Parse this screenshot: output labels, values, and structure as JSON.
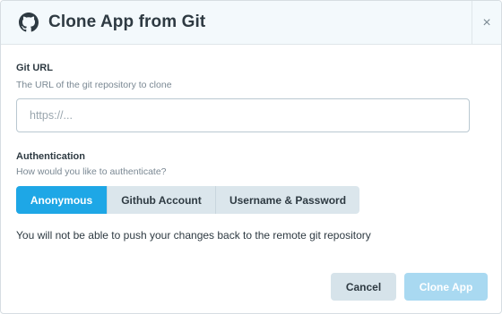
{
  "dialog": {
    "title": "Clone App from Git",
    "close_symbol": "×"
  },
  "icons": {
    "header_icon": "github-icon",
    "close_icon": "close-icon"
  },
  "git_url": {
    "label": "Git URL",
    "help": "The URL of the git repository to clone",
    "value": "",
    "placeholder": "https://..."
  },
  "authentication": {
    "label": "Authentication",
    "help": "How would you like to authenticate?",
    "options": [
      "Anonymous",
      "Github Account",
      "Username & Password"
    ],
    "selected": "Anonymous",
    "notice": "You will not be able to push your changes back to the remote git repository"
  },
  "footer": {
    "cancel_label": "Cancel",
    "clone_label": "Clone App"
  },
  "colors": {
    "accent": "#1ea7e6",
    "header_bg": "#f3f9fc",
    "secondary_button": "#d6e3ea",
    "disabled_primary": "#a9d9f1"
  }
}
